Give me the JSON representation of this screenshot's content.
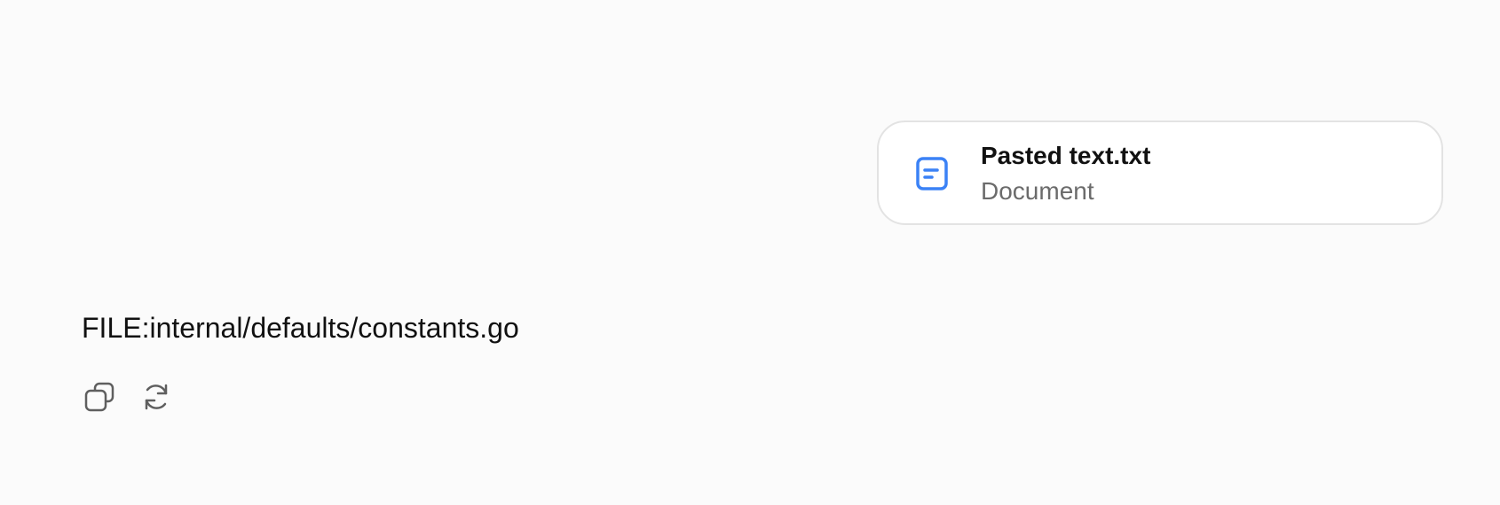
{
  "attachment": {
    "file_name": "Pasted text.txt",
    "file_type": "Document",
    "icon": "document-icon",
    "accent_color": "#3b82f6"
  },
  "response": {
    "text": "FILE:internal/defaults/constants.go"
  },
  "actions": [
    {
      "icon": "copy-icon"
    },
    {
      "icon": "refresh-icon"
    }
  ]
}
